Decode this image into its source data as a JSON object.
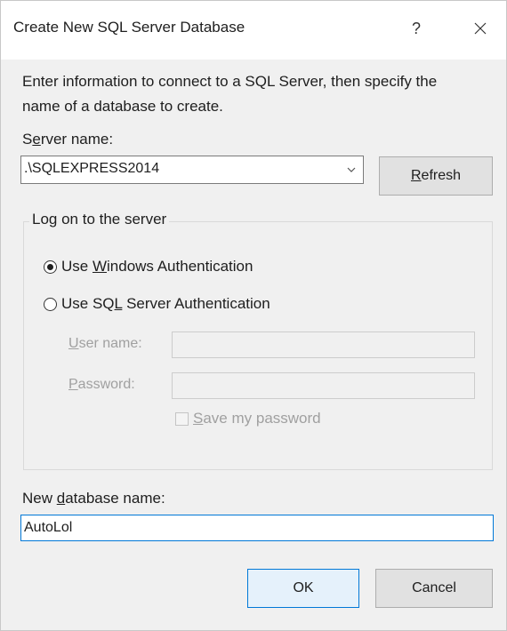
{
  "window": {
    "title": "Create New SQL Server Database",
    "help_label": "?",
    "close_icon": "close-icon"
  },
  "instructions": {
    "line1": "Enter information to connect to a SQL Server, then specify the",
    "line2": "name of a database to create."
  },
  "server": {
    "label_pre": "S",
    "label_key": "e",
    "label_post": "rver name:",
    "value": ".\\SQLEXPRESS2014",
    "refresh_key": "R",
    "refresh_rest": "efresh"
  },
  "logon": {
    "group_title": "Log on to the server",
    "windows_auth": {
      "pre": "Use ",
      "key": "W",
      "post": "indows Authentication",
      "selected": true
    },
    "sql_auth": {
      "pre": "Use SQ",
      "key": "L",
      "post": " Server Authentication",
      "selected": false
    },
    "username": {
      "key": "U",
      "post": "ser name:",
      "value": ""
    },
    "password": {
      "key": "P",
      "post": "assword:",
      "value": ""
    },
    "save_password": {
      "key": "S",
      "post": "ave my password",
      "checked": false
    }
  },
  "database": {
    "label_pre": "New ",
    "label_key": "d",
    "label_post": "atabase name:",
    "value": "AutoLol"
  },
  "footer": {
    "ok_label": "OK",
    "cancel_label": "Cancel"
  },
  "colors": {
    "accent": "#0078d7",
    "dialog_bg": "#f0f0f0",
    "disabled_text": "#a0a0a0"
  }
}
